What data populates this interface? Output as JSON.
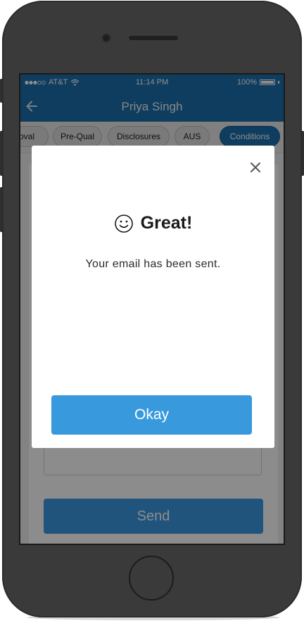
{
  "status_bar": {
    "carrier": "AT&T",
    "time": "11:14 PM",
    "battery": "100%"
  },
  "nav": {
    "title": "Priya Singh",
    "back_icon": "arrow-left-icon"
  },
  "tabs": [
    {
      "label": "oval",
      "active": false
    },
    {
      "label": "Pre-Qual",
      "active": false
    },
    {
      "label": "Disclosures",
      "active": false
    },
    {
      "label": "AUS",
      "active": false
    },
    {
      "label": "Conditions",
      "active": true
    }
  ],
  "form": {
    "send_label": "Send"
  },
  "modal": {
    "title": "Great!",
    "message": "Your email has been sent.",
    "okay_label": "Okay",
    "title_icon": "smiley-icon",
    "close_icon": "close-icon"
  },
  "colors": {
    "brand": "#1c6fad",
    "button": "#3899dd"
  }
}
